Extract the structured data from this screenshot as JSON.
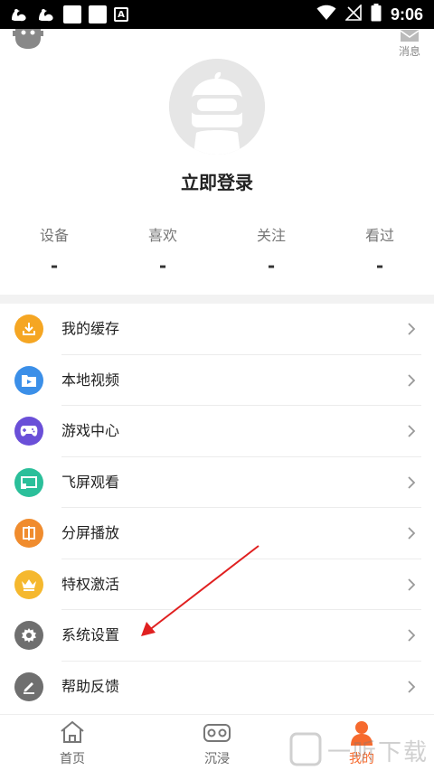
{
  "status_bar": {
    "time": "9:06",
    "a_badge": "A"
  },
  "header": {
    "message_label": "消息",
    "login_label": "立即登录"
  },
  "stats": [
    {
      "label": "设备",
      "value": "-"
    },
    {
      "label": "喜欢",
      "value": "-"
    },
    {
      "label": "关注",
      "value": "-"
    },
    {
      "label": "看过",
      "value": "-"
    }
  ],
  "menu": [
    {
      "label": "我的缓存",
      "icon": "download-icon",
      "color": "#f5a623"
    },
    {
      "label": "本地视频",
      "icon": "video-folder-icon",
      "color": "#3b8fe8"
    },
    {
      "label": "游戏中心",
      "icon": "gamepad-icon",
      "color": "#6a4fd8"
    },
    {
      "label": "飞屏观看",
      "icon": "cast-screen-icon",
      "color": "#2bbf9a"
    },
    {
      "label": "分屏播放",
      "icon": "split-screen-icon",
      "color": "#f08c2e"
    },
    {
      "label": "特权激活",
      "icon": "crown-icon",
      "color": "#f5b82e"
    },
    {
      "label": "系统设置",
      "icon": "gear-icon",
      "color": "#6f6f6f"
    },
    {
      "label": "帮助反馈",
      "icon": "pencil-icon",
      "color": "#6f6f6f"
    }
  ],
  "bottom_nav": [
    {
      "label": "首页",
      "icon": "home-icon",
      "active": false
    },
    {
      "label": "沉浸",
      "icon": "vr-headset-icon",
      "active": false
    },
    {
      "label": "我的",
      "icon": "person-icon",
      "active": true
    }
  ],
  "watermark": {
    "text": "一听下载"
  },
  "colors": {
    "accent": "#f66a2e",
    "annotation_arrow": "#e02020"
  }
}
